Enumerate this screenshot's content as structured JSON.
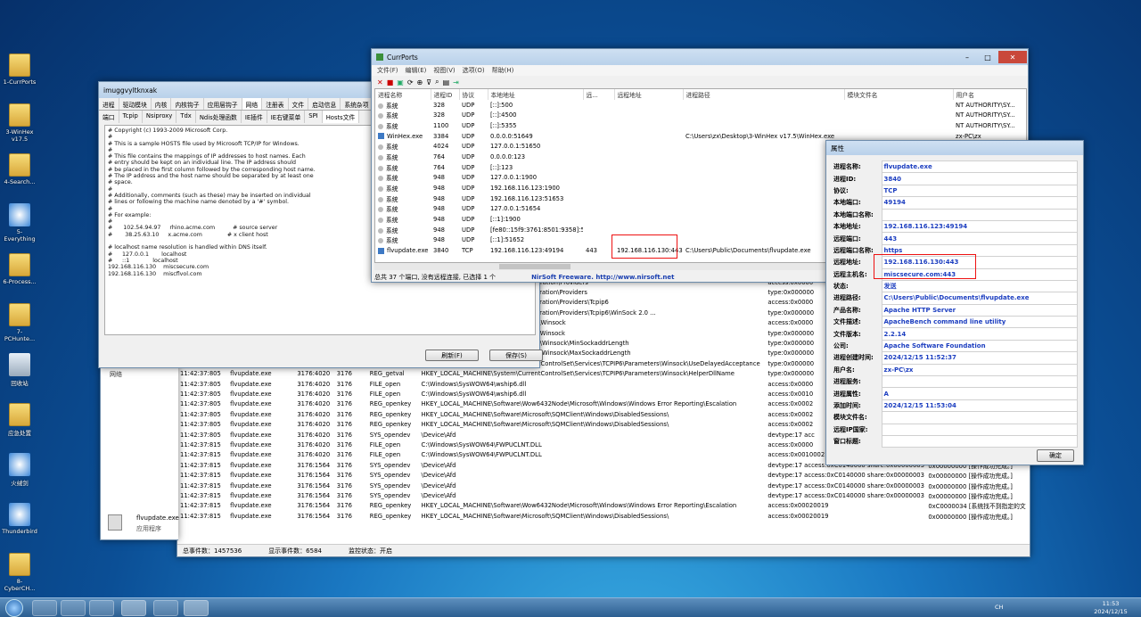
{
  "desktop": {
    "icons": [
      {
        "label": "1-CurrPorts",
        "kind": "folder"
      },
      {
        "label": "3-WinHex v17.5",
        "kind": "folder"
      },
      {
        "label": "4-Search...",
        "kind": "folder"
      },
      {
        "label": "5-Everything",
        "kind": "app"
      },
      {
        "label": "6-Process...",
        "kind": "folder"
      },
      {
        "label": "7-PCHunte...",
        "kind": "folder"
      },
      {
        "label": "回收站",
        "kind": "bin"
      },
      {
        "label": "应急处置",
        "kind": "folder"
      },
      {
        "label": "火绒剑",
        "kind": "app"
      },
      {
        "label": "Thunderbird",
        "kind": "app"
      },
      {
        "label": "8-CyberCH...",
        "kind": "folder"
      }
    ]
  },
  "hosts_window": {
    "title": "imuggvyltknxak",
    "tabs_row1": [
      "进程",
      "驱动模块",
      "内核",
      "内核钩子",
      "应用层钩子",
      "网络",
      "注册表",
      "文件",
      "启动信息",
      "系统杂项",
      "电"
    ],
    "tabs_row2": [
      "端口",
      "Tcpip",
      "Nsiproxy",
      "Tdx",
      "Ndis处理函数",
      "IE插件",
      "IE右键菜单",
      "SPI",
      "Hosts文件"
    ],
    "content_lines": [
      "# Copyright (c) 1993-2009 Microsoft Corp.",
      "#",
      "# This is a sample HOSTS file used by Microsoft TCP/IP for Windows.",
      "#",
      "# This file contains the mappings of IP addresses to host names. Each",
      "# entry should be kept on an individual line. The IP address should",
      "# be placed in the first column followed by the corresponding host name.",
      "# The IP address and the host name should be separated by at least one",
      "# space.",
      "#",
      "# Additionally, comments (such as these) may be inserted on individual",
      "# lines or following the machine name denoted by a '#' symbol.",
      "#",
      "# For example:",
      "#",
      "#      102.54.94.97     rhino.acme.com          # source server",
      "#       38.25.63.10     x.acme.com              # x client host",
      "",
      "# localhost name resolution is handled within DNS itself.",
      "#\t127.0.0.1       localhost",
      "#\t::1             localhost",
      "192.168.116.130    miscsecure.com",
      "192.168.116.130    miscflvol.com"
    ],
    "refresh_label": "刷新(F)",
    "save_label": "保存(S)",
    "bottom_label": "网络"
  },
  "currports": {
    "title": "CurrPorts",
    "menu": [
      "文件(F)",
      "编辑(E)",
      "视图(V)",
      "选项(O)",
      "帮助(H)"
    ],
    "columns": [
      "进程名称",
      "进程ID",
      "协议",
      "本地地址",
      "远...",
      "远程地址",
      "进程路径",
      "模块文件名",
      "用户名"
    ],
    "rows": [
      [
        "系统",
        "328",
        "UDP",
        "[::]:500",
        "",
        "",
        "",
        "",
        "NT AUTHORITY\\SY..."
      ],
      [
        "系统",
        "328",
        "UDP",
        "[::]:4500",
        "",
        "",
        "",
        "",
        "NT AUTHORITY\\SY..."
      ],
      [
        "系统",
        "1100",
        "UDP",
        "[::]:5355",
        "",
        "",
        "",
        "",
        "NT AUTHORITY\\SY..."
      ],
      [
        "WinHex.exe",
        "3384",
        "UDP",
        "0.0.0.0:51649",
        "",
        "",
        "C:\\Users\\zx\\Desktop\\3-WinHex v17.5\\WinHex.exe",
        "",
        "zx-PC\\zx"
      ],
      [
        "系统",
        "4024",
        "UDP",
        "127.0.0.1:51650",
        "",
        "",
        "",
        "",
        "NT AUTHORITY\\SY..."
      ],
      [
        "系统",
        "764",
        "UDP",
        "0.0.0.0:123",
        "",
        "",
        "",
        "",
        "NT AUTHORITY\\SY..."
      ],
      [
        "系统",
        "764",
        "UDP",
        "[::]:123",
        "",
        "",
        "",
        "",
        "NT AUTHORITY\\SY..."
      ],
      [
        "系统",
        "948",
        "UDP",
        "127.0.0.1:1900",
        "",
        "",
        "",
        "",
        "NT AUTHORITY\\SY..."
      ],
      [
        "系统",
        "948",
        "UDP",
        "192.168.116.123:1900",
        "",
        "",
        "",
        "",
        "NT AUTHORITY\\SY..."
      ],
      [
        "系统",
        "948",
        "UDP",
        "192.168.116.123:51653",
        "",
        "",
        "",
        "",
        "NT AUTHORITY\\SY..."
      ],
      [
        "系统",
        "948",
        "UDP",
        "127.0.0.1:51654",
        "",
        "",
        "",
        "",
        "NT AUTHORITY\\SY..."
      ],
      [
        "系统",
        "948",
        "UDP",
        "[::1]:1900",
        "",
        "",
        "",
        "",
        "NT AUTHORITY\\SY..."
      ],
      [
        "系统",
        "948",
        "UDP",
        "[fe80::15f9:3761:8501:9358]:5...",
        "",
        "",
        "",
        "",
        "NT AUTHORITY\\SY..."
      ],
      [
        "系统",
        "948",
        "UDP",
        "[::1]:51652",
        "",
        "",
        "",
        "",
        "NT AUTHORITY\\SY..."
      ],
      [
        "flvupdate.exe",
        "3840",
        "TCP",
        "192.168.116.123:49194",
        "443",
        "192.168.116.130:443",
        "C:\\Users\\Public\\Documents\\flvupdate.exe",
        "",
        "zx-PC\\zx"
      ]
    ],
    "status_left": "总共 37 个端口, 没有远程连接, 已选择 1 个",
    "status_mid": "NirSoft Freeware.  http://www.nirsoft.net"
  },
  "procmon": {
    "rows": [
      [
        "",
        "",
        "",
        "",
        "",
        "ControlSet\\Services\\Winsock\\Setup Migration\\Providers",
        "access:0x0000"
      ],
      [
        "",
        "",
        "",
        "",
        "",
        "ControlSet\\services\\Winsock\\Setup Migration\\Providers",
        "type:0x000000"
      ],
      [
        "",
        "",
        "",
        "",
        "",
        "ControlSet\\services\\Winsock\\Setup Migration\\Providers\\Tcpip6",
        "access:0x0000"
      ],
      [
        "",
        "",
        "",
        "",
        "",
        "ControlSet\\services\\Winsock\\Setup Migration\\Providers\\Tcpip6\\WinSock 2.0 ...",
        "type:0x000000"
      ],
      [
        "",
        "",
        "",
        "",
        "",
        "ControlSet\\Services\\Tcpip6\\Parameters\\Winsock",
        "access:0x0000"
      ],
      [
        "",
        "",
        "",
        "",
        "",
        "ControlSet\\services\\Tcpip6\\Parameters\\Winsock",
        "type:0x000000"
      ],
      [
        "",
        "",
        "",
        "",
        "",
        "ControlSet\\Services\\TCPIP6\\Parameters\\Winsock\\MinSockaddrLength",
        "type:0x000000"
      ],
      [
        "",
        "",
        "",
        "",
        "",
        "ControlSet\\Services\\TCPIP6\\Parameters\\Winsock\\MaxSockaddrLength",
        "type:0x000000"
      ],
      [
        "11:42:37:805",
        "flvupdate.exe",
        "3176:4020",
        "3176",
        "REG_getval",
        "HKEY_LOCAL_MACHINE\\System\\CurrentControlSet\\Services\\TCPIP6\\Parameters\\Winsock\\UseDelayedAcceptance",
        "type:0x000000"
      ],
      [
        "11:42:37:805",
        "flvupdate.exe",
        "3176:4020",
        "3176",
        "REG_getval",
        "HKEY_LOCAL_MACHINE\\System\\CurrentControlSet\\Services\\TCPIP6\\Parameters\\Winsock\\HelperDllName",
        "type:0x000000"
      ],
      [
        "11:42:37:805",
        "flvupdate.exe",
        "3176:4020",
        "3176",
        "FILE_open",
        "C:\\Windows\\SysWOW64\\wship6.dll",
        "access:0x0000"
      ],
      [
        "11:42:37:805",
        "flvupdate.exe",
        "3176:4020",
        "3176",
        "FILE_open",
        "C:\\Windows\\SysWOW64\\wship6.dll",
        "access:0x0010"
      ],
      [
        "11:42:37:805",
        "flvupdate.exe",
        "3176:4020",
        "3176",
        "REG_openkey",
        "HKEY_LOCAL_MACHINE\\Software\\Wow6432Node\\Microsoft\\Windows\\Windows Error Reporting\\Escalation",
        "access:0x0002"
      ],
      [
        "11:42:37:805",
        "flvupdate.exe",
        "3176:4020",
        "3176",
        "REG_openkey",
        "HKEY_LOCAL_MACHINE\\Software\\Microsoft\\SQMClient\\Windows\\DisabledSessions\\",
        "access:0x0002"
      ],
      [
        "11:42:37:805",
        "flvupdate.exe",
        "3176:4020",
        "3176",
        "REG_openkey",
        "HKEY_LOCAL_MACHINE\\Software\\Microsoft\\SQMClient\\Windows\\DisabledSessions\\",
        "access:0x0002"
      ],
      [
        "11:42:37:805",
        "flvupdate.exe",
        "3176:4020",
        "3176",
        "SYS_opendev",
        "\\Device\\Afd",
        "devtype:17 acc"
      ],
      [
        "11:42:37:815",
        "flvupdate.exe",
        "3176:4020",
        "3176",
        "FILE_open",
        "C:\\Windows\\SysWOW64\\FWPUCLNT.DLL",
        "access:0x0000"
      ],
      [
        "11:42:37:815",
        "flvupdate.exe",
        "3176:4020",
        "3176",
        "FILE_open",
        "C:\\Windows\\SysWOW64\\FWPUCLNT.DLL",
        "access:0x00100021 alloc_size:0 attrib:0x00000000 ...",
        "0x00000000 [操作成功完成。]"
      ],
      [
        "11:42:37:815",
        "flvupdate.exe",
        "3176:1564",
        "3176",
        "SYS_opendev",
        "\\Device\\Afd",
        "devtype:17 access:0xC0140000 share:0x00000003",
        "0x00000000 [操作成功完成。]"
      ],
      [
        "11:42:37:815",
        "flvupdate.exe",
        "3176:1564",
        "3176",
        "SYS_opendev",
        "\\Device\\Afd",
        "devtype:17 access:0xC0140000 share:0x00000003",
        "0x00000000 [操作成功完成。]"
      ],
      [
        "11:42:37:815",
        "flvupdate.exe",
        "3176:1564",
        "3176",
        "SYS_opendev",
        "\\Device\\Afd",
        "devtype:17 access:0xC0140000 share:0x00000003",
        "0x00000000 [操作成功完成。]"
      ],
      [
        "11:42:37:815",
        "flvupdate.exe",
        "3176:1564",
        "3176",
        "SYS_opendev",
        "\\Device\\Afd",
        "devtype:17 access:0xC0140000 share:0x00000003",
        "0x00000000 [操作成功完成。]"
      ],
      [
        "11:42:37:815",
        "flvupdate.exe",
        "3176:1564",
        "3176",
        "REG_openkey",
        "HKEY_LOCAL_MACHINE\\Software\\Wow6432Node\\Microsoft\\Windows\\Windows Error Reporting\\Escalation",
        "access:0x00020019",
        "0xC0000034 [系统找不到指定的文"
      ],
      [
        "11:42:37:815",
        "flvupdate.exe",
        "3176:1564",
        "3176",
        "REG_openkey",
        "HKEY_LOCAL_MACHINE\\Software\\Microsoft\\SQMClient\\Windows\\DisabledSessions\\",
        "access:0x00020019",
        "0x00000000 [操作成功完成。]"
      ]
    ],
    "status": [
      "总事件数：1457536",
      "显示事件数：6584",
      "监控状态：开启"
    ],
    "proc_name": "flvupdate.exe",
    "proc_type": "应用程序"
  },
  "props": {
    "title": "属性",
    "rows": [
      [
        "进程名称:",
        "flvupdate.exe"
      ],
      [
        "进程ID:",
        "3840"
      ],
      [
        "协议:",
        "TCP"
      ],
      [
        "本地端口:",
        "49194"
      ],
      [
        "本地端口名称:",
        ""
      ],
      [
        "本地地址:",
        "192.168.116.123:49194"
      ],
      [
        "远程端口:",
        "443"
      ],
      [
        "远程端口名称:",
        "https"
      ],
      [
        "远程地址:",
        "192.168.116.130:443"
      ],
      [
        "远程主机名:",
        "miscsecure.com:443"
      ],
      [
        "状态:",
        "发送"
      ],
      [
        "进程路径:",
        "C:\\Users\\Public\\Documents\\flvupdate.exe"
      ],
      [
        "产品名称:",
        "Apache HTTP Server"
      ],
      [
        "文件描述:",
        "ApacheBench command line utility"
      ],
      [
        "文件版本:",
        "2.2.14"
      ],
      [
        "公司:",
        "Apache Software Foundation"
      ],
      [
        "进程创建时间:",
        "2024/12/15 11:52:37"
      ],
      [
        "用户名:",
        "zx-PC\\zx"
      ],
      [
        "进程服务:",
        ""
      ],
      [
        "进程属性:",
        "A"
      ],
      [
        "添加时间:",
        "2024/12/15 11:53:04"
      ],
      [
        "模块文件名:",
        ""
      ],
      [
        "远程IP国家:",
        ""
      ],
      [
        "窗口标题:",
        ""
      ]
    ],
    "ok_label": "确定"
  },
  "taskbar": {
    "lang": "CH",
    "time": "11:53",
    "date": "2024/12/15"
  }
}
